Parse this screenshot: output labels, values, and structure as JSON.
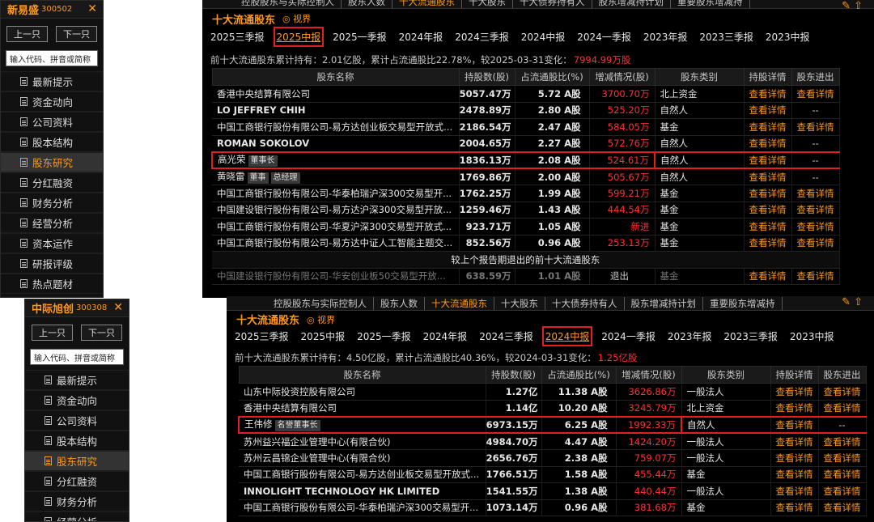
{
  "top": {
    "sidebar": {
      "name": "新易盛",
      "code": "300502",
      "prev": "上一只",
      "next": "下一只",
      "search": "输入代码、拼音或简称",
      "menu": [
        "最新提示",
        "资金动向",
        "公司资料",
        "股本结构",
        "股东研究",
        "分红融资",
        "财务分析",
        "经营分析",
        "资本运作",
        "研报评级",
        "热点题材"
      ],
      "active": 4
    },
    "tabs": [
      "控股股东与实际控制人",
      "股东人数",
      "十大流通股东",
      "十大股东",
      "十大债券持有人",
      "股东增减持计划",
      "重要股东增减持"
    ],
    "active_tab": 2,
    "section_title": "十大流通股东",
    "eye_label": "视界",
    "periods": [
      "2025三季报",
      "2025中报",
      "2025一季报",
      "2024年报",
      "2024三季报",
      "2024中报",
      "2024一季报",
      "2023年报",
      "2023三季报",
      "2023中报"
    ],
    "active_period": 1,
    "summary": "前十大流通股东累计持有：2.01亿股，累计占流通股比22.78%，较2025-03-31变化：",
    "summary_change": "7994.99万股",
    "headers": [
      "股东名称",
      "持股数(股)",
      "占流通股比(%)",
      "增减情况(股)",
      "股东类别",
      "持股详情",
      "股东进出"
    ],
    "rows": [
      {
        "name": "香港中央结算有限公司",
        "shares": "5057.47万",
        "ratio": "5.72 A股",
        "change": "3700.70万",
        "type": "北上资金",
        "detail": "查看详情",
        "flow": "查看详情"
      },
      {
        "name": "LO JEFFREY CHIH",
        "shares": "2478.89万",
        "ratio": "2.80 A股",
        "change": "525.20万",
        "type": "自然人",
        "detail": "查看详情",
        "flow": "--"
      },
      {
        "name": "中国工商银行股份有限公司-易方达创业板交易型开放式...",
        "shares": "2186.54万",
        "ratio": "2.47 A股",
        "change": "584.05万",
        "type": "基金",
        "detail": "查看详情",
        "flow": "查看详情"
      },
      {
        "name": "ROMAN SOKOLOV",
        "shares": "2004.65万",
        "ratio": "2.27 A股",
        "change": "572.76万",
        "type": "自然人",
        "detail": "查看详情",
        "flow": "--"
      },
      {
        "name": "高光荣",
        "badges": [
          "董事长"
        ],
        "shares": "1836.13万",
        "ratio": "2.08 A股",
        "change": "524.61万",
        "type": "自然人",
        "detail": "查看详情",
        "flow": "--",
        "hl": true
      },
      {
        "name": "黄晓雷",
        "badges": [
          "董事",
          "总经理"
        ],
        "shares": "1769.86万",
        "ratio": "2.00 A股",
        "change": "505.67万",
        "type": "自然人",
        "detail": "查看详情",
        "flow": "--"
      },
      {
        "name": "中国工商银行股份有限公司-华泰柏瑞沪深300交易型开...",
        "shares": "1762.25万",
        "ratio": "1.99 A股",
        "change": "599.21万",
        "type": "基金",
        "detail": "查看详情",
        "flow": "查看详情"
      },
      {
        "name": "中国建设银行股份有限公司-易方达沪深300交易型开放...",
        "shares": "1259.46万",
        "ratio": "1.43 A股",
        "change": "444.54万",
        "type": "基金",
        "detail": "查看详情",
        "flow": "查看详情"
      },
      {
        "name": "中国工商银行股份有限公司-华夏沪深300交易型开放式...",
        "shares": "923.71万",
        "ratio": "1.05 A股",
        "change": "新进",
        "type": "基金",
        "detail": "查看详情",
        "flow": "查看详情"
      },
      {
        "name": "中国工商银行股份有限公司-易方达中证人工智能主题交...",
        "shares": "852.56万",
        "ratio": "0.96 A股",
        "change": "253.13万",
        "type": "基金",
        "detail": "查看详情",
        "flow": "查看详情"
      }
    ],
    "exit_title": "较上个报告期退出的前十大流通股东",
    "exit_rows": [
      {
        "name": "中国建设银行股份有限公司-华安创业板50交易型开放...",
        "shares": "638.59万",
        "ratio": "1.01 A股",
        "change": "退出",
        "type": "基金",
        "detail": "查看详情",
        "flow": "查看详情"
      }
    ]
  },
  "bottom": {
    "sidebar": {
      "name": "中际旭创",
      "code": "300308",
      "prev": "上一只",
      "next": "下一只",
      "search": "输入代码、拼音或简称",
      "menu": [
        "最新提示",
        "资金动向",
        "公司资料",
        "股本结构",
        "股东研究",
        "分红融资",
        "财务分析",
        "经营分析"
      ],
      "active": 4
    },
    "tabs": [
      "控股股东与实际控制人",
      "股东人数",
      "十大流通股东",
      "十大股东",
      "十大债券持有人",
      "股东增减持计划",
      "重要股东增减持"
    ],
    "active_tab": 2,
    "section_title": "十大流通股东",
    "eye_label": "视界",
    "periods": [
      "2025三季报",
      "2025中报",
      "2025一季报",
      "2024年报",
      "2024三季报",
      "2024中报",
      "2024一季报",
      "2023年报",
      "2023三季报",
      "2023中报"
    ],
    "active_period": 5,
    "summary": "前十大流通股东累计持有：4.50亿股，累计占流通股比40.36%，较2024-03-31变化：",
    "summary_change": "1.25亿股",
    "headers": [
      "股东名称",
      "持股数(股)",
      "占流通股比(%)",
      "增减情况(股)",
      "股东类别",
      "持股详情",
      "股东进出"
    ],
    "rows": [
      {
        "name": "山东中际投资控股有限公司",
        "shares": "1.27亿",
        "ratio": "11.38 A股",
        "change": "3626.86万",
        "type": "一般法人",
        "detail": "查看详情",
        "flow": "查看详情"
      },
      {
        "name": "香港中央结算有限公司",
        "shares": "1.14亿",
        "ratio": "10.20 A股",
        "change": "3245.79万",
        "type": "北上资金",
        "detail": "查看详情",
        "flow": "查看详情"
      },
      {
        "name": "王伟修",
        "badges": [
          "名誉董事长"
        ],
        "shares": "6973.15万",
        "ratio": "6.25 A股",
        "change": "1992.33万",
        "type": "自然人",
        "detail": "查看详情",
        "flow": "--",
        "hl": true
      },
      {
        "name": "苏州益兴福企业管理中心(有限合伙)",
        "shares": "4984.70万",
        "ratio": "4.47 A股",
        "change": "1424.20万",
        "type": "一般法人",
        "detail": "查看详情",
        "flow": "查看详情"
      },
      {
        "name": "苏州云昌锦企业管理中心(有限合伙)",
        "shares": "2656.76万",
        "ratio": "2.38 A股",
        "change": "759.07万",
        "type": "一般法人",
        "detail": "查看详情",
        "flow": "查看详情"
      },
      {
        "name": "中国工商银行股份有限公司-易方达创业板交易型开放式...",
        "shares": "1766.51万",
        "ratio": "1.58 A股",
        "change": "455.44万",
        "type": "基金",
        "detail": "查看详情",
        "flow": "查看详情"
      },
      {
        "name": "INNOLIGHT TECHNOLOGY HK LIMITED",
        "shares": "1541.55万",
        "ratio": "1.38 A股",
        "change": "440.44万",
        "type": "一般法人",
        "detail": "查看详情",
        "flow": "查看详情"
      },
      {
        "name": "中国工商银行股份有限公司-华泰柏瑞沪深300交易型开...",
        "shares": "1073.14万",
        "ratio": "0.96 A股",
        "change": "381.68万",
        "type": "基金",
        "detail": "查看详情",
        "flow": "查看详情"
      }
    ]
  }
}
